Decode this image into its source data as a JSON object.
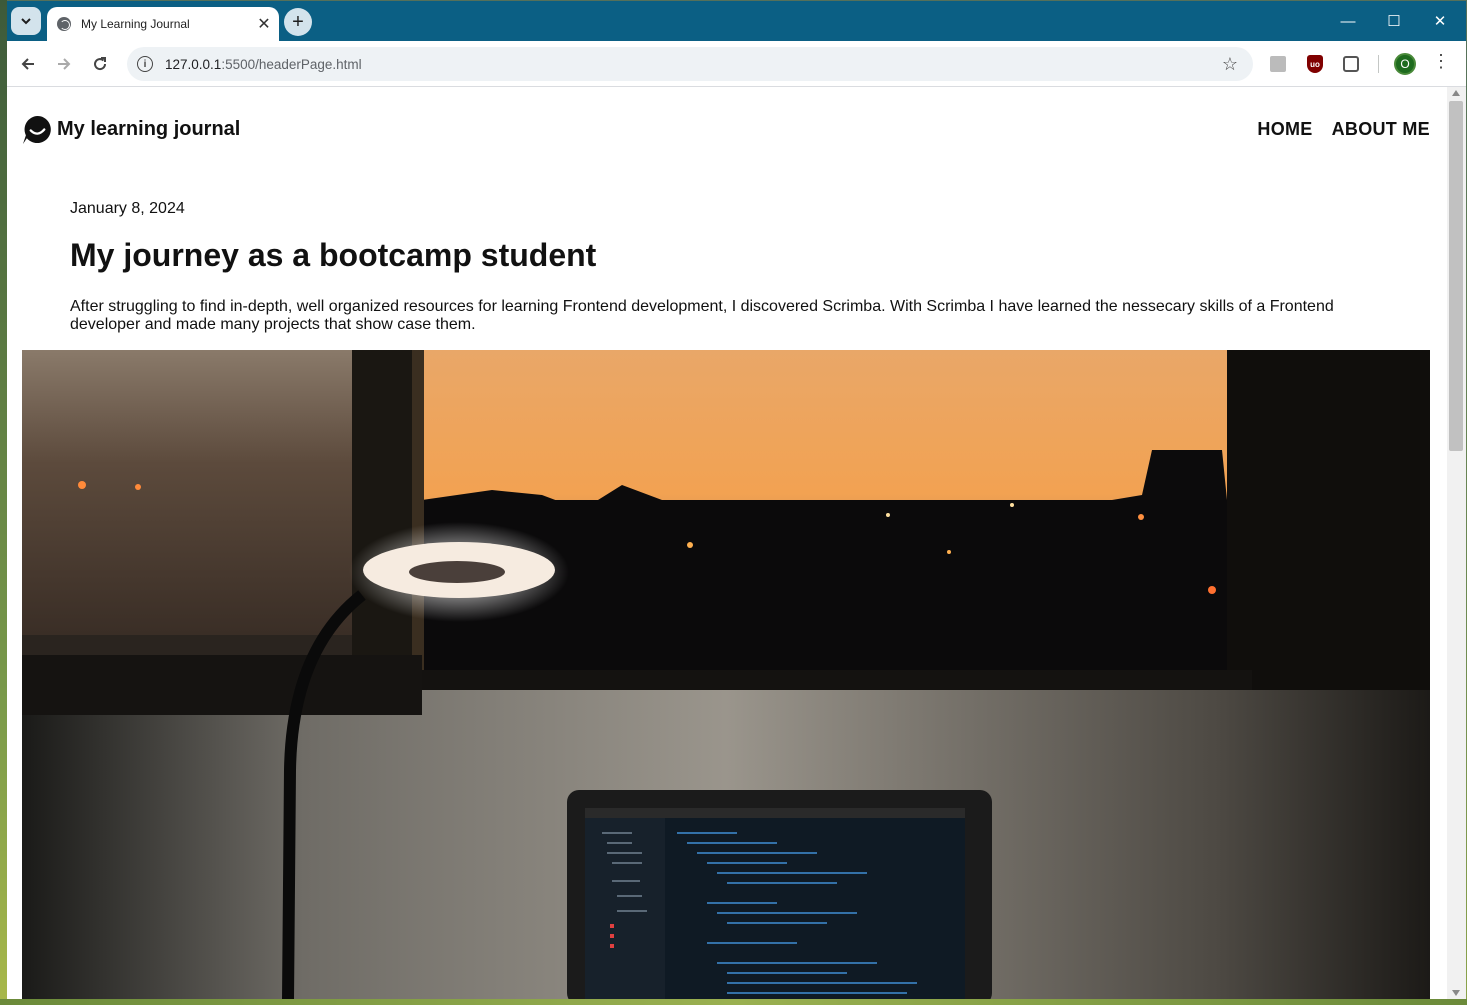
{
  "browser": {
    "tab_title": "My Learning Journal",
    "url_host": "127.0.0.1",
    "url_rest": ":5500/headerPage.html",
    "profile_initial": "O",
    "accent_color": "#0b5f84"
  },
  "site": {
    "brand_name": "My learning journal",
    "nav": [
      "HOME",
      "ABOUT ME"
    ]
  },
  "post": {
    "date": "January 8, 2024",
    "title": "My journey as a bootcamp student",
    "excerpt": "After struggling to find in-depth, well organized resources for learning Frontend development, I discovered Scrimba. With Scrimba I have learned the nessecary skills of a Frontend developer and made many projects that show case them."
  },
  "icons": [
    "tab-search-icon",
    "globe-icon",
    "close-icon",
    "plus-icon",
    "minimize-icon",
    "maximize-icon",
    "window-close-icon",
    "back-arrow-icon",
    "forward-arrow-icon",
    "reload-icon",
    "site-info-icon",
    "bookmark-star-icon",
    "extension-icon",
    "ublock-icon",
    "puzzle-icon",
    "kebab-menu-icon",
    "logo-icon"
  ]
}
